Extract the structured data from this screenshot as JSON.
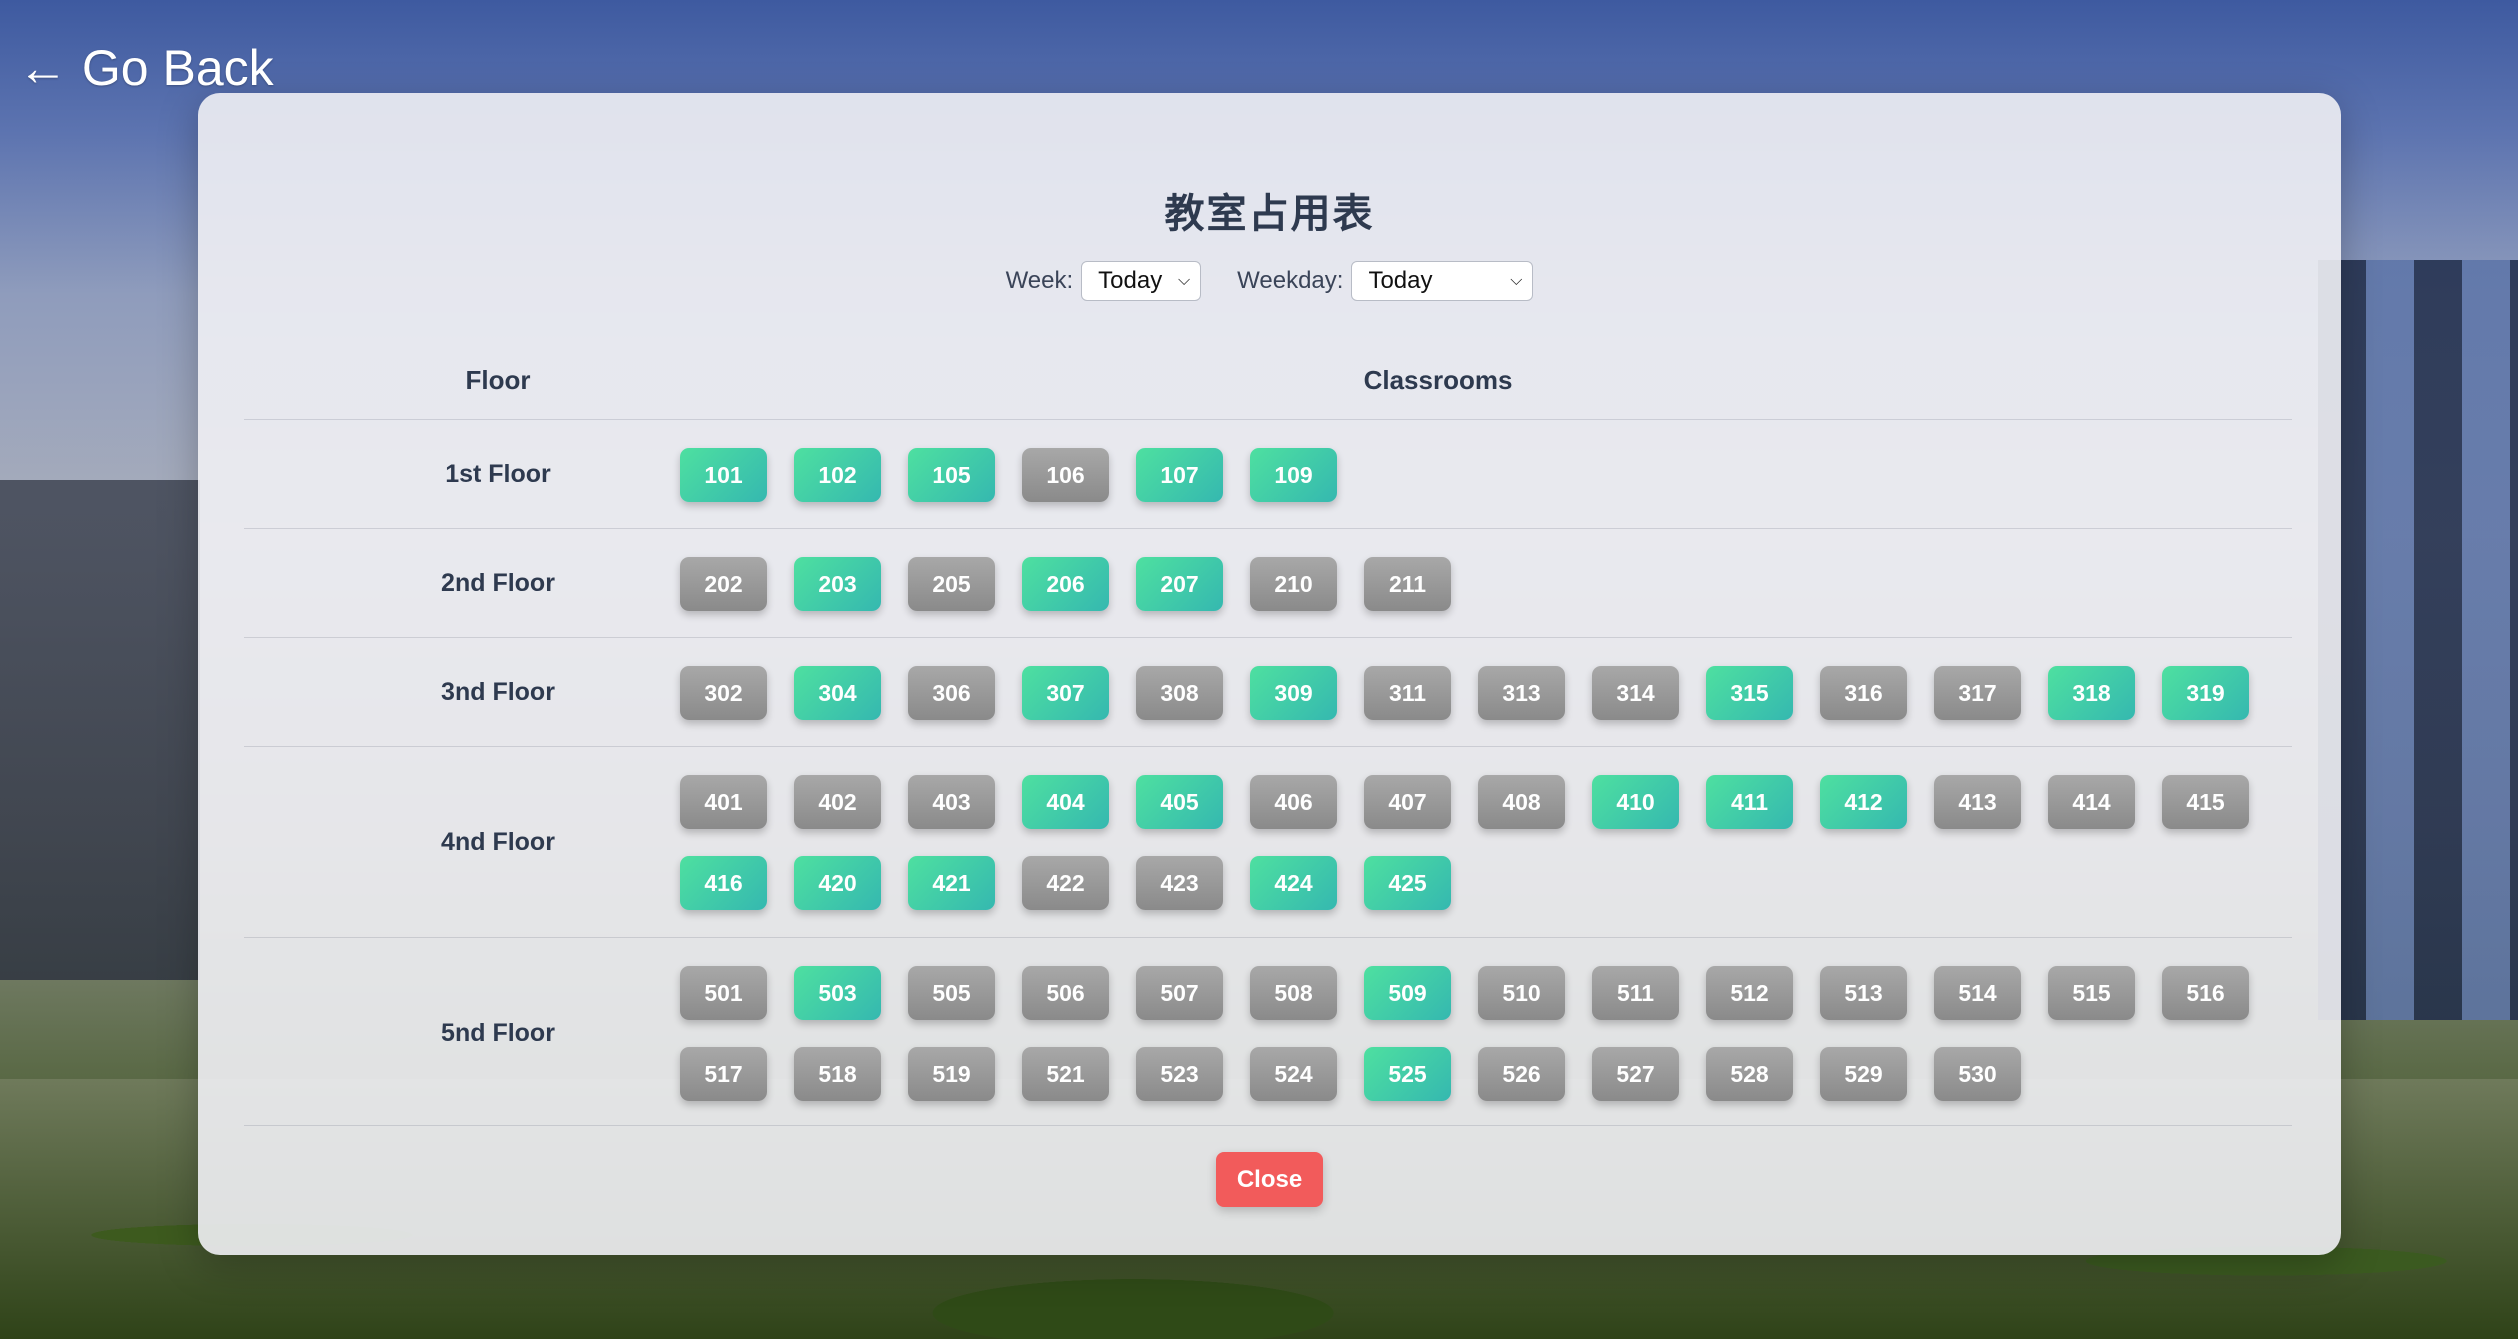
{
  "nav": {
    "go_back_label": "← Go Back"
  },
  "modal": {
    "title": "教室占用表",
    "filters": {
      "week_label": "Week:",
      "week_value": "Today",
      "weekday_label": "Weekday:",
      "weekday_value": "Today"
    },
    "headers": {
      "floor": "Floor",
      "classrooms": "Classrooms"
    },
    "floors": [
      {
        "label": "1st Floor",
        "rooms": [
          {
            "number": "101",
            "status": "free"
          },
          {
            "number": "102",
            "status": "free"
          },
          {
            "number": "105",
            "status": "free"
          },
          {
            "number": "106",
            "status": "busy"
          },
          {
            "number": "107",
            "status": "free"
          },
          {
            "number": "109",
            "status": "free"
          }
        ]
      },
      {
        "label": "2nd Floor",
        "rooms": [
          {
            "number": "202",
            "status": "busy"
          },
          {
            "number": "203",
            "status": "free"
          },
          {
            "number": "205",
            "status": "busy"
          },
          {
            "number": "206",
            "status": "free"
          },
          {
            "number": "207",
            "status": "free"
          },
          {
            "number": "210",
            "status": "busy"
          },
          {
            "number": "211",
            "status": "busy"
          }
        ]
      },
      {
        "label": "3nd Floor",
        "rooms": [
          {
            "number": "302",
            "status": "busy"
          },
          {
            "number": "304",
            "status": "free"
          },
          {
            "number": "306",
            "status": "busy"
          },
          {
            "number": "307",
            "status": "free"
          },
          {
            "number": "308",
            "status": "busy"
          },
          {
            "number": "309",
            "status": "free"
          },
          {
            "number": "311",
            "status": "busy"
          },
          {
            "number": "313",
            "status": "busy"
          },
          {
            "number": "314",
            "status": "busy"
          },
          {
            "number": "315",
            "status": "free"
          },
          {
            "number": "316",
            "status": "busy"
          },
          {
            "number": "317",
            "status": "busy"
          },
          {
            "number": "318",
            "status": "free"
          },
          {
            "number": "319",
            "status": "free"
          }
        ]
      },
      {
        "label": "4nd Floor",
        "rooms": [
          {
            "number": "401",
            "status": "busy"
          },
          {
            "number": "402",
            "status": "busy"
          },
          {
            "number": "403",
            "status": "busy"
          },
          {
            "number": "404",
            "status": "free"
          },
          {
            "number": "405",
            "status": "free"
          },
          {
            "number": "406",
            "status": "busy"
          },
          {
            "number": "407",
            "status": "busy"
          },
          {
            "number": "408",
            "status": "busy"
          },
          {
            "number": "410",
            "status": "free"
          },
          {
            "number": "411",
            "status": "free"
          },
          {
            "number": "412",
            "status": "free"
          },
          {
            "number": "413",
            "status": "busy"
          },
          {
            "number": "414",
            "status": "busy"
          },
          {
            "number": "415",
            "status": "busy"
          },
          {
            "number": "416",
            "status": "free"
          },
          {
            "number": "420",
            "status": "free"
          },
          {
            "number": "421",
            "status": "free"
          },
          {
            "number": "422",
            "status": "busy"
          },
          {
            "number": "423",
            "status": "busy"
          },
          {
            "number": "424",
            "status": "free"
          },
          {
            "number": "425",
            "status": "free"
          }
        ]
      },
      {
        "label": "5nd Floor",
        "rooms": [
          {
            "number": "501",
            "status": "busy"
          },
          {
            "number": "503",
            "status": "free"
          },
          {
            "number": "505",
            "status": "busy"
          },
          {
            "number": "506",
            "status": "busy"
          },
          {
            "number": "507",
            "status": "busy"
          },
          {
            "number": "508",
            "status": "busy"
          },
          {
            "number": "509",
            "status": "free"
          },
          {
            "number": "510",
            "status": "busy"
          },
          {
            "number": "511",
            "status": "busy"
          },
          {
            "number": "512",
            "status": "busy"
          },
          {
            "number": "513",
            "status": "busy"
          },
          {
            "number": "514",
            "status": "busy"
          },
          {
            "number": "515",
            "status": "busy"
          },
          {
            "number": "516",
            "status": "busy"
          },
          {
            "number": "517",
            "status": "busy"
          },
          {
            "number": "518",
            "status": "busy"
          },
          {
            "number": "519",
            "status": "busy"
          },
          {
            "number": "521",
            "status": "busy"
          },
          {
            "number": "523",
            "status": "busy"
          },
          {
            "number": "524",
            "status": "busy"
          },
          {
            "number": "525",
            "status": "free"
          },
          {
            "number": "526",
            "status": "busy"
          },
          {
            "number": "527",
            "status": "busy"
          },
          {
            "number": "528",
            "status": "busy"
          },
          {
            "number": "529",
            "status": "busy"
          },
          {
            "number": "530",
            "status": "busy"
          }
        ]
      }
    ],
    "close_label": "Close",
    "colors": {
      "free": "#3fd0a4",
      "busy": "#999999",
      "close": "#f25b5b"
    }
  }
}
